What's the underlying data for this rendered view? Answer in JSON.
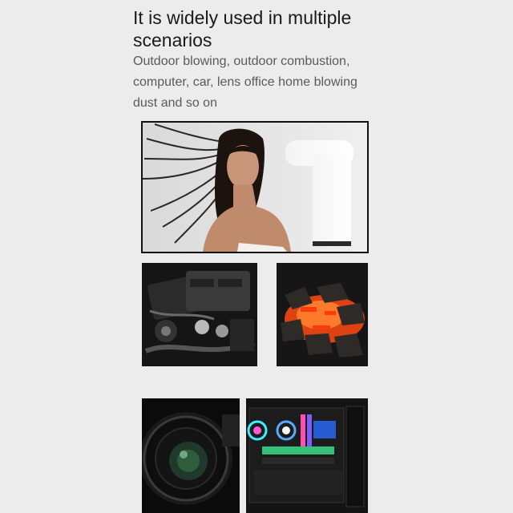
{
  "header": {
    "title_line1": "It is widely used in multiple",
    "title_line2": "scenarios"
  },
  "description": {
    "line1": "Outdoor blowing, outdoor combustion,",
    "line2": "computer, car, lens office home blowing",
    "line3": "dust and so on"
  },
  "colors": {
    "background": "#ececec",
    "title": "#1a1a1a",
    "description": "#5a5a5a",
    "frame_border": "#111111"
  }
}
